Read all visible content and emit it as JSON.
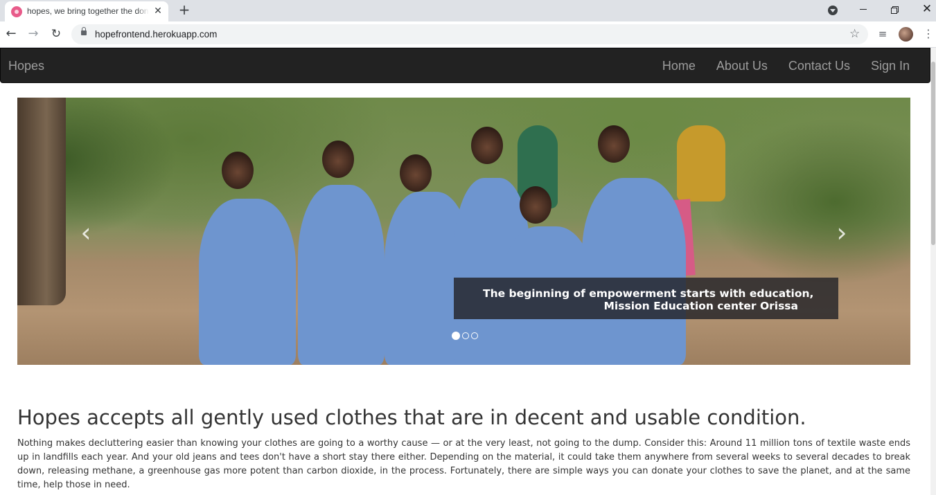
{
  "browser": {
    "tab_title": "hopes, we bring together the donors",
    "tab_close": "✕",
    "new_tab": "+",
    "url": "hopefrontend.herokuapp.com",
    "icons": {
      "back": "arrow-left-icon",
      "forward": "arrow-right-icon",
      "reload": "reload-icon",
      "lock": "lock-icon",
      "bookmark": "star-icon",
      "media": "media-controls-icon",
      "menu": "kebab-menu-icon"
    }
  },
  "navbar": {
    "brand": "Hopes",
    "links": [
      "Home",
      "About Us",
      "Contact Us",
      "Sign In"
    ],
    "background": "#222222",
    "link_color": "#9d9d9d"
  },
  "carousel": {
    "prev_symbol": "‹",
    "next_symbol": "›",
    "caption_line1": "The beginning of empowerment starts with education,",
    "caption_line2": "Mission Education center Orissa",
    "slide_count": 3,
    "active_slide": 1
  },
  "content": {
    "headline": "Hopes accepts all gently used clothes that are in decent and usable condition.",
    "paragraph": "Nothing makes decluttering easier than knowing your clothes are going to a worthy cause — or at the very least, not going to the dump. Consider this: Around 11 million tons of textile waste ends up in landfills each year. And your old jeans and tees don't have a short stay there either. Depending on the material, it could take them anywhere from several weeks to several decades to break down, releasing methane, a greenhouse gas more potent than carbon dioxide, in the process. Fortunately, there are simple ways you can donate your clothes to save the planet, and at the same time, help those in need."
  }
}
